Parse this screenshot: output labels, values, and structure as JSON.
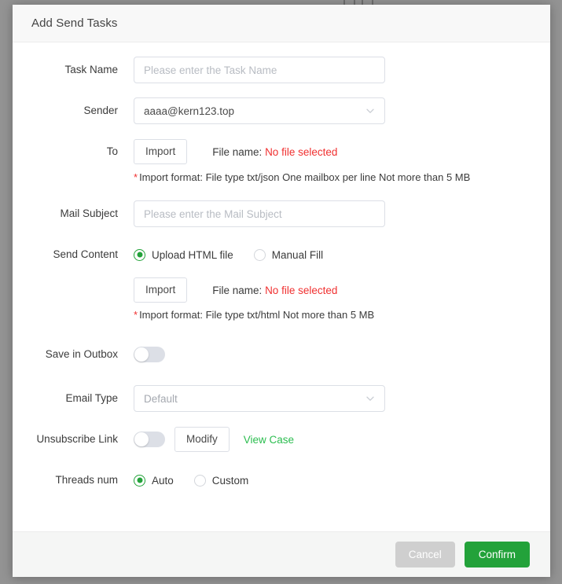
{
  "dialog": {
    "title": "Add Send Tasks",
    "footer": {
      "cancel_label": "Cancel",
      "confirm_label": "Confirm"
    }
  },
  "form": {
    "task_name": {
      "label": "Task Name",
      "placeholder": "Please enter the Task Name",
      "value": ""
    },
    "sender": {
      "label": "Sender",
      "value": "aaaa@kern123.top"
    },
    "to": {
      "label": "To",
      "import_label": "Import",
      "file_name_label": "File name:",
      "file_name_value": "No file selected",
      "hint_star": "*",
      "hint": "Import format: File type txt/json One mailbox per line Not more than 5 MB"
    },
    "mail_subject": {
      "label": "Mail Subject",
      "placeholder": "Please enter the Mail Subject",
      "value": ""
    },
    "send_content": {
      "label": "Send Content",
      "options": [
        {
          "label": "Upload HTML file",
          "checked": true
        },
        {
          "label": "Manual Fill",
          "checked": false
        }
      ],
      "import_label": "Import",
      "file_name_label": "File name:",
      "file_name_value": "No file selected",
      "hint_star": "*",
      "hint": "Import format: File type txt/html Not more than 5 MB"
    },
    "save_in_outbox": {
      "label": "Save in Outbox",
      "enabled": false
    },
    "email_type": {
      "label": "Email Type",
      "value": "Default"
    },
    "unsubscribe_link": {
      "label": "Unsubscribe Link",
      "enabled": false,
      "modify_label": "Modify",
      "view_case_label": "View Case"
    },
    "threads_num": {
      "label": "Threads num",
      "options": [
        {
          "label": "Auto",
          "checked": true
        },
        {
          "label": "Custom",
          "checked": false
        }
      ]
    }
  },
  "colors": {
    "accent_green": "#23a23a",
    "link_green": "#2bbd4f",
    "danger_red": "#f03030",
    "header_bg": "#f8f8f8",
    "footer_bg": "#f5f6f5"
  }
}
